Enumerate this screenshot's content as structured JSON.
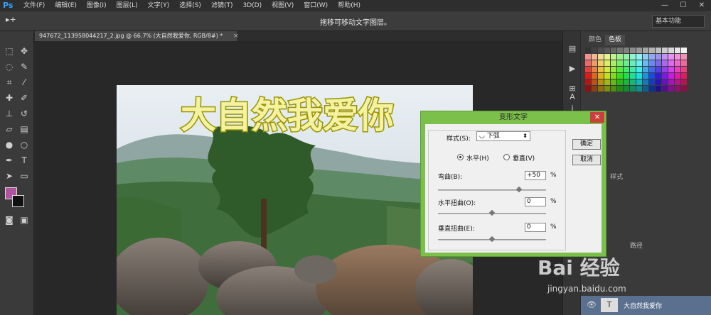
{
  "app": {
    "logo": "Ps",
    "menu": [
      "文件(F)",
      "编辑(E)",
      "图像(I)",
      "图层(L)",
      "文字(Y)",
      "选择(S)",
      "滤镜(T)",
      "3D(D)",
      "视图(V)",
      "窗口(W)",
      "帮助(H)"
    ],
    "window_controls": [
      "—",
      "☐",
      "✕"
    ]
  },
  "options_bar": {
    "tool_glyph": "▸+",
    "hint": "拖移可移动文字图层。",
    "workspace": "基本功能"
  },
  "document": {
    "tab_title": "947672_113958044217_2.jpg @ 66.7% (大自然我爱你, RGB/8#) *",
    "close": "×"
  },
  "canvas": {
    "overlay_text": "大自然我爱你"
  },
  "panels": {
    "tabs": [
      "颜色",
      "色板"
    ],
    "styles_tab": "样式",
    "paths_tab": "路径",
    "layer_name": "大自然我爱你",
    "layer_type_icon": "T"
  },
  "dialog": {
    "title": "变形文字",
    "close": "✕",
    "style_label": "样式(S):",
    "style_value": "下弧",
    "horizontal_label": "水平(H)",
    "vertical_label": "垂直(V)",
    "bend_label": "弯曲(B):",
    "bend_value": "+50",
    "hdistort_label": "水平扭曲(O):",
    "hdistort_value": "0",
    "vdistort_label": "垂直扭曲(E):",
    "vdistort_value": "0",
    "percent": "%",
    "ok": "确定",
    "cancel": "取消",
    "bend_fraction": 0.75,
    "hdistort_fraction": 0.5,
    "vdistort_fraction": 0.5
  },
  "watermark": {
    "brand": "Bai 经验",
    "url": "jingyan.baidu.com"
  },
  "colors": {
    "foreground": "#b054a0",
    "background": "#111111",
    "dialog_frame": "#7cc04c",
    "text_fill": "#f4f2a0",
    "text_stroke": "#9a9400"
  }
}
